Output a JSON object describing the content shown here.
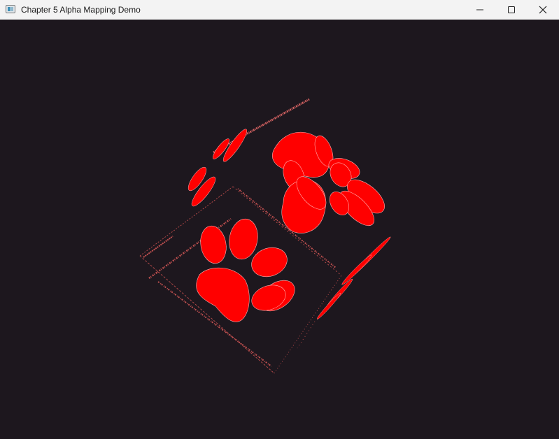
{
  "window": {
    "title": "Chapter 5 Alpha Mapping Demo",
    "controls": {
      "minimize": "minimize",
      "maximize": "maximize",
      "close": "close"
    }
  },
  "viewport": {
    "background_color": "#1d171e",
    "paw_color": "#ff0000",
    "edge_text_color": "#e06060"
  }
}
